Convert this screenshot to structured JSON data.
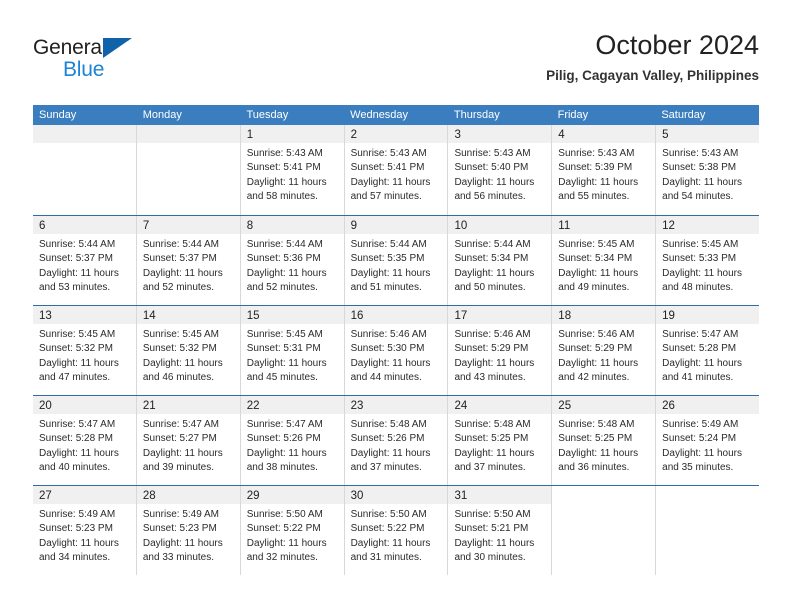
{
  "brand": {
    "name_part1": "General",
    "name_part2": "Blue",
    "triangle_color": "#1063a8",
    "blue_color": "#1c84d4"
  },
  "header": {
    "title": "October 2024",
    "location": "Pilig, Cagayan Valley, Philippines"
  },
  "theme": {
    "header_bar_color": "#3a7ebf",
    "row_divider_color": "#2f6ea5",
    "daynum_band_color": "#f0f0f0",
    "cell_divider_color": "#d8d8d8"
  },
  "weekdays": [
    "Sunday",
    "Monday",
    "Tuesday",
    "Wednesday",
    "Thursday",
    "Friday",
    "Saturday"
  ],
  "weeks": [
    [
      {
        "day": "",
        "blank": true
      },
      {
        "day": "",
        "blank": true
      },
      {
        "day": "1",
        "sunrise": "Sunrise: 5:43 AM",
        "sunset": "Sunset: 5:41 PM",
        "daylight": "Daylight: 11 hours and 58 minutes."
      },
      {
        "day": "2",
        "sunrise": "Sunrise: 5:43 AM",
        "sunset": "Sunset: 5:41 PM",
        "daylight": "Daylight: 11 hours and 57 minutes."
      },
      {
        "day": "3",
        "sunrise": "Sunrise: 5:43 AM",
        "sunset": "Sunset: 5:40 PM",
        "daylight": "Daylight: 11 hours and 56 minutes."
      },
      {
        "day": "4",
        "sunrise": "Sunrise: 5:43 AM",
        "sunset": "Sunset: 5:39 PM",
        "daylight": "Daylight: 11 hours and 55 minutes."
      },
      {
        "day": "5",
        "sunrise": "Sunrise: 5:43 AM",
        "sunset": "Sunset: 5:38 PM",
        "daylight": "Daylight: 11 hours and 54 minutes."
      }
    ],
    [
      {
        "day": "6",
        "sunrise": "Sunrise: 5:44 AM",
        "sunset": "Sunset: 5:37 PM",
        "daylight": "Daylight: 11 hours and 53 minutes."
      },
      {
        "day": "7",
        "sunrise": "Sunrise: 5:44 AM",
        "sunset": "Sunset: 5:37 PM",
        "daylight": "Daylight: 11 hours and 52 minutes."
      },
      {
        "day": "8",
        "sunrise": "Sunrise: 5:44 AM",
        "sunset": "Sunset: 5:36 PM",
        "daylight": "Daylight: 11 hours and 52 minutes."
      },
      {
        "day": "9",
        "sunrise": "Sunrise: 5:44 AM",
        "sunset": "Sunset: 5:35 PM",
        "daylight": "Daylight: 11 hours and 51 minutes."
      },
      {
        "day": "10",
        "sunrise": "Sunrise: 5:44 AM",
        "sunset": "Sunset: 5:34 PM",
        "daylight": "Daylight: 11 hours and 50 minutes."
      },
      {
        "day": "11",
        "sunrise": "Sunrise: 5:45 AM",
        "sunset": "Sunset: 5:34 PM",
        "daylight": "Daylight: 11 hours and 49 minutes."
      },
      {
        "day": "12",
        "sunrise": "Sunrise: 5:45 AM",
        "sunset": "Sunset: 5:33 PM",
        "daylight": "Daylight: 11 hours and 48 minutes."
      }
    ],
    [
      {
        "day": "13",
        "sunrise": "Sunrise: 5:45 AM",
        "sunset": "Sunset: 5:32 PM",
        "daylight": "Daylight: 11 hours and 47 minutes."
      },
      {
        "day": "14",
        "sunrise": "Sunrise: 5:45 AM",
        "sunset": "Sunset: 5:32 PM",
        "daylight": "Daylight: 11 hours and 46 minutes."
      },
      {
        "day": "15",
        "sunrise": "Sunrise: 5:45 AM",
        "sunset": "Sunset: 5:31 PM",
        "daylight": "Daylight: 11 hours and 45 minutes."
      },
      {
        "day": "16",
        "sunrise": "Sunrise: 5:46 AM",
        "sunset": "Sunset: 5:30 PM",
        "daylight": "Daylight: 11 hours and 44 minutes."
      },
      {
        "day": "17",
        "sunrise": "Sunrise: 5:46 AM",
        "sunset": "Sunset: 5:29 PM",
        "daylight": "Daylight: 11 hours and 43 minutes."
      },
      {
        "day": "18",
        "sunrise": "Sunrise: 5:46 AM",
        "sunset": "Sunset: 5:29 PM",
        "daylight": "Daylight: 11 hours and 42 minutes."
      },
      {
        "day": "19",
        "sunrise": "Sunrise: 5:47 AM",
        "sunset": "Sunset: 5:28 PM",
        "daylight": "Daylight: 11 hours and 41 minutes."
      }
    ],
    [
      {
        "day": "20",
        "sunrise": "Sunrise: 5:47 AM",
        "sunset": "Sunset: 5:28 PM",
        "daylight": "Daylight: 11 hours and 40 minutes."
      },
      {
        "day": "21",
        "sunrise": "Sunrise: 5:47 AM",
        "sunset": "Sunset: 5:27 PM",
        "daylight": "Daylight: 11 hours and 39 minutes."
      },
      {
        "day": "22",
        "sunrise": "Sunrise: 5:47 AM",
        "sunset": "Sunset: 5:26 PM",
        "daylight": "Daylight: 11 hours and 38 minutes."
      },
      {
        "day": "23",
        "sunrise": "Sunrise: 5:48 AM",
        "sunset": "Sunset: 5:26 PM",
        "daylight": "Daylight: 11 hours and 37 minutes."
      },
      {
        "day": "24",
        "sunrise": "Sunrise: 5:48 AM",
        "sunset": "Sunset: 5:25 PM",
        "daylight": "Daylight: 11 hours and 37 minutes."
      },
      {
        "day": "25",
        "sunrise": "Sunrise: 5:48 AM",
        "sunset": "Sunset: 5:25 PM",
        "daylight": "Daylight: 11 hours and 36 minutes."
      },
      {
        "day": "26",
        "sunrise": "Sunrise: 5:49 AM",
        "sunset": "Sunset: 5:24 PM",
        "daylight": "Daylight: 11 hours and 35 minutes."
      }
    ],
    [
      {
        "day": "27",
        "sunrise": "Sunrise: 5:49 AM",
        "sunset": "Sunset: 5:23 PM",
        "daylight": "Daylight: 11 hours and 34 minutes."
      },
      {
        "day": "28",
        "sunrise": "Sunrise: 5:49 AM",
        "sunset": "Sunset: 5:23 PM",
        "daylight": "Daylight: 11 hours and 33 minutes."
      },
      {
        "day": "29",
        "sunrise": "Sunrise: 5:50 AM",
        "sunset": "Sunset: 5:22 PM",
        "daylight": "Daylight: 11 hours and 32 minutes."
      },
      {
        "day": "30",
        "sunrise": "Sunrise: 5:50 AM",
        "sunset": "Sunset: 5:22 PM",
        "daylight": "Daylight: 11 hours and 31 minutes."
      },
      {
        "day": "31",
        "sunrise": "Sunrise: 5:50 AM",
        "sunset": "Sunset: 5:21 PM",
        "daylight": "Daylight: 11 hours and 30 minutes."
      },
      {
        "day": "",
        "blank": true
      },
      {
        "day": "",
        "blank": true
      }
    ]
  ]
}
